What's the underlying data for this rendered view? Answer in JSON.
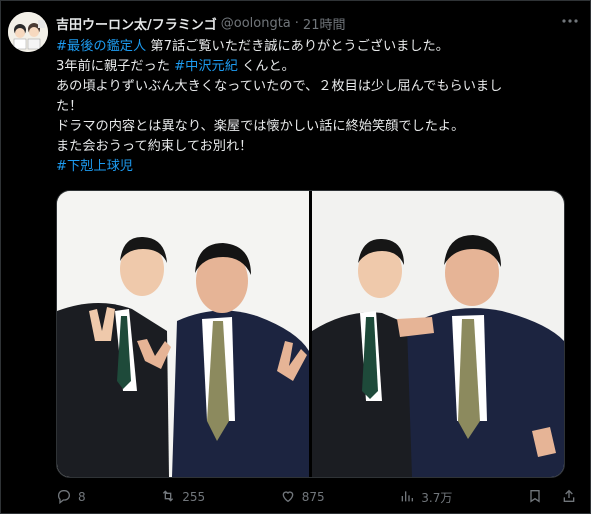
{
  "user": {
    "display_name": "吉田ウーロン太/フラミンゴ",
    "handle": "@oolongta",
    "separator": "·",
    "time": "21時間"
  },
  "tweet": {
    "line1_tag": "#最後の鑑定人",
    "line1_text": " 第7話ご覧いただき誠にありがとうございました。",
    "line2_pre": "3年前に親子だった ",
    "line2_tag": "#中沢元紀",
    "line2_post": " くんと。",
    "line3": "あの頃よりずいぶん大きくなっていたので、２枚目は少し屈んでもらいまし",
    "line4": "た！",
    "line5": "ドラマの内容とは異なり、楽屋では懐かしい話に終始笑顔でしたよ。",
    "line6": "また会おうって約束してお別れ！",
    "line7_tag": "#下剋上球児"
  },
  "actions": {
    "replies": "8",
    "reposts": "255",
    "likes": "875",
    "views": "3.7万"
  },
  "icons": [
    "avatar",
    "more-icon",
    "reply-icon",
    "repost-icon",
    "like-icon",
    "views-icon",
    "bookmark-icon",
    "share-icon"
  ],
  "colors": {
    "accent": "#1d9bf0",
    "muted": "#71767b",
    "text": "#e7e9ea",
    "background": "#000000"
  }
}
